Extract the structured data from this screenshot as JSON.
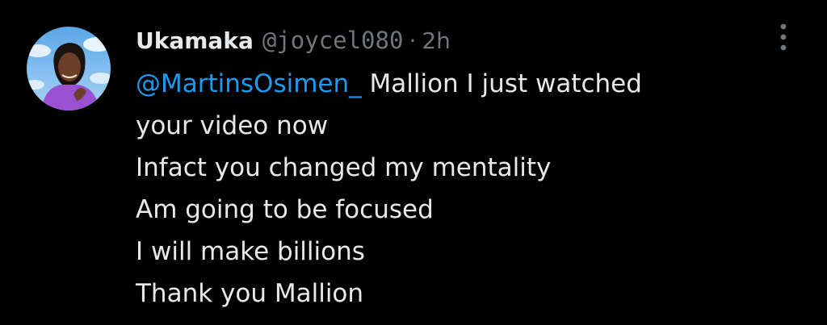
{
  "tweet": {
    "author": {
      "display_name": "Ukamaka",
      "handle": "@joycel080",
      "separator": "·",
      "time": "2h",
      "avatar_icon": "user-avatar-photo"
    },
    "more_icon": "more-options-icon",
    "mention": "@MartinsOsimen_",
    "first_line_text": " Mallion I just watched",
    "lines": [
      "your video now",
      "Infact you changed my mentality",
      "Am going to be focused",
      "I will make billions",
      "Thank you Mallion"
    ]
  },
  "colors": {
    "background": "#000000",
    "text": "#e7e9ea",
    "secondary": "#71767b",
    "link": "#1d9bf0"
  }
}
